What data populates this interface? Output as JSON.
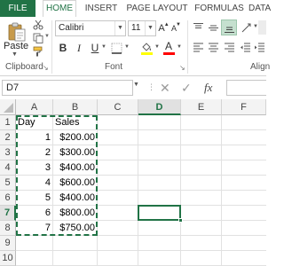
{
  "ribbon_tabs": [
    "FILE",
    "HOME",
    "INSERT",
    "PAGE LAYOUT",
    "FORMULAS",
    "DATA"
  ],
  "clipboard": {
    "paste_label": "Paste",
    "group_label": "Clipboard"
  },
  "font": {
    "name": "Calibri",
    "size": "11",
    "group_label": "Font",
    "bold": "B",
    "italic": "I",
    "underline": "U",
    "grow": "A",
    "shrink": "A",
    "font_color_glyph": "A",
    "font_color": "#ff0000",
    "highlight_color": "#ffff00"
  },
  "alignment": {
    "group_label": "Align"
  },
  "name_box": "D7",
  "formula_icons": {
    "cancel": "✕",
    "enter": "✓",
    "fx": "fx"
  },
  "columns": [
    "A",
    "B",
    "C",
    "D",
    "E",
    "F"
  ],
  "rows": [
    "1",
    "2",
    "3",
    "4",
    "5",
    "6",
    "7",
    "8",
    "9",
    "10"
  ],
  "cells": {
    "headers": [
      "Day",
      "Sales"
    ],
    "data": [
      [
        "1",
        "$200.00"
      ],
      [
        "2",
        "$300.00"
      ],
      [
        "3",
        "$400.00"
      ],
      [
        "4",
        "$600.00"
      ],
      [
        "5",
        "$400.00"
      ],
      [
        "6",
        "$800.00"
      ],
      [
        "7",
        "$750.00"
      ]
    ]
  },
  "selected_cell": "D7",
  "accent_color": "#217346"
}
